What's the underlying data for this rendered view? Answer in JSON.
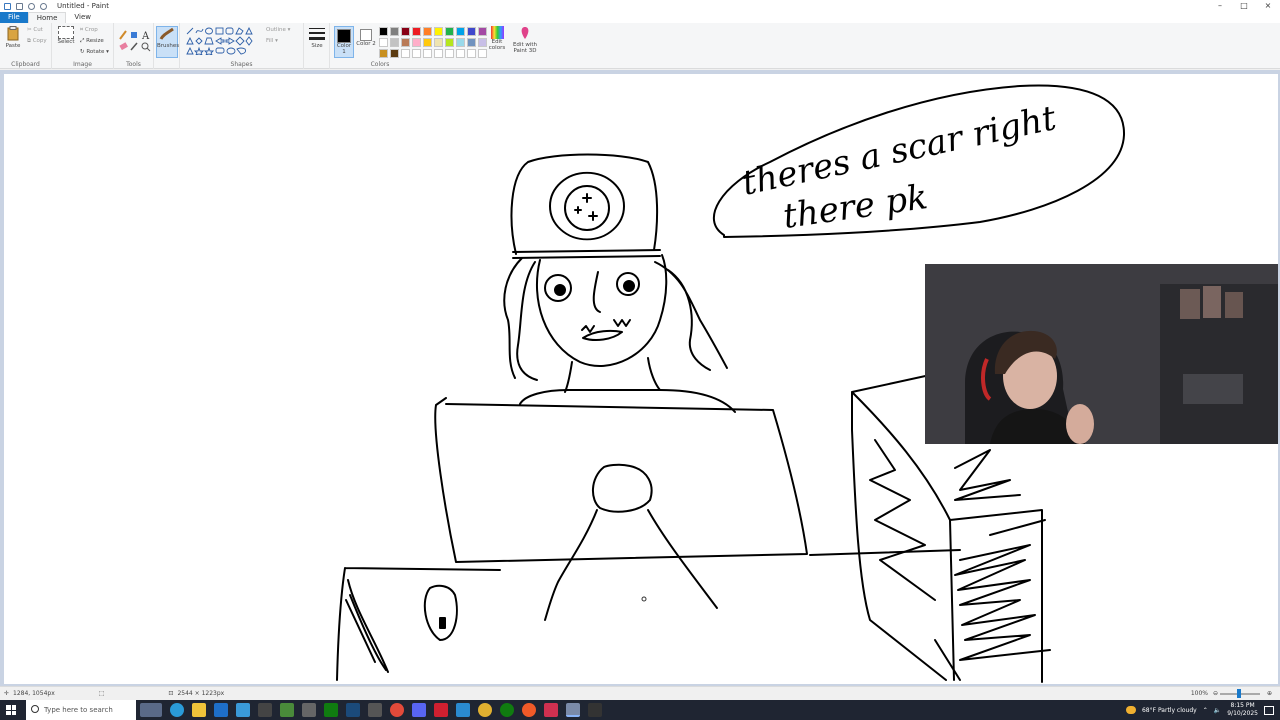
{
  "window": {
    "title": "Untitled - Paint",
    "minimize": "–",
    "maximize": "□",
    "close": "×"
  },
  "tabs": [
    {
      "label": "File"
    },
    {
      "label": "Home"
    },
    {
      "label": "View"
    }
  ],
  "ribbon": {
    "clipboard": {
      "label": "Clipboard",
      "paste": "Paste",
      "cut": "Cut",
      "copy": "Copy"
    },
    "image": {
      "label": "Image",
      "select": "Select",
      "crop": "Crop",
      "resize": "Resize",
      "rotate": "Rotate ▾"
    },
    "tools": {
      "label": "Tools"
    },
    "brushes": {
      "label": "Brushes"
    },
    "shapes": {
      "label": "Shapes",
      "outline": "Outline ▾",
      "fill": "Fill ▾"
    },
    "size": {
      "label": "Size"
    },
    "colors": {
      "label": "Colors",
      "color1": "Color 1",
      "color2": "Color 2",
      "edit_colors": "Edit colors",
      "edit_3d": "Edit with Paint 3D",
      "palette_row1": [
        "#000000",
        "#7f7f7f",
        "#880015",
        "#ed1c24",
        "#ff7f27",
        "#fff200",
        "#22b14c",
        "#00a2e8",
        "#3f48cc",
        "#a349a4"
      ],
      "palette_row2": [
        "#ffffff",
        "#c3c3c3",
        "#b97a57",
        "#ffaec9",
        "#ffc90e",
        "#efe4b0",
        "#b5e61d",
        "#99d9ea",
        "#7092be",
        "#c8bfe7"
      ],
      "palette_row3": [
        "#c89020",
        "#5a3a10",
        "#ffffff",
        "#ffffff",
        "#ffffff",
        "#ffffff",
        "#ffffff",
        "#ffffff",
        "#ffffff",
        "#ffffff"
      ]
    }
  },
  "drawing": {
    "speech_line1": "theres a scar right",
    "speech_line2": "there pk"
  },
  "status": {
    "cursor": "1284, 1054px",
    "canvas_size": "2544 × 1223px",
    "zoom": "100%"
  },
  "taskbar": {
    "search_placeholder": "Type here to search",
    "weather": "68°F Partly cloudy",
    "time": "8:15 PM",
    "date": "9/10/2025"
  }
}
